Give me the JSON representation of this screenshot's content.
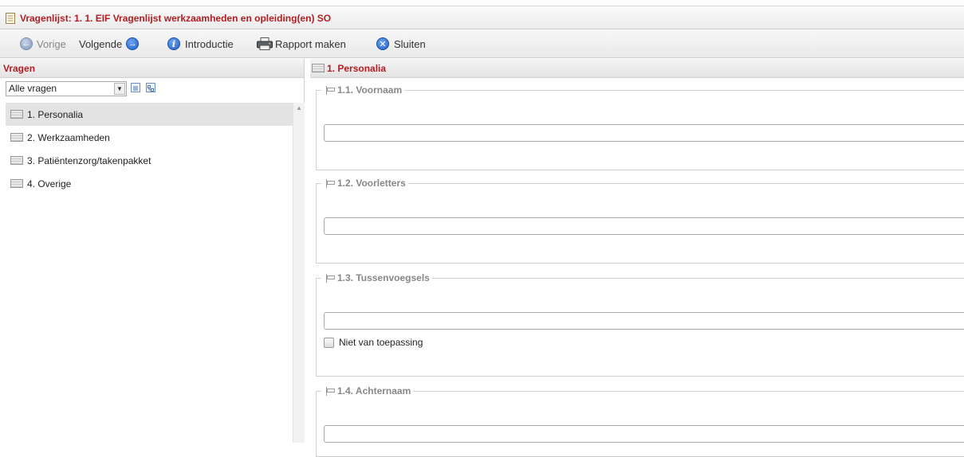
{
  "window": {
    "title": "Vragenlijst: 1. 1. EIF Vragenlijst werkzaamheden en opleiding(en) SO"
  },
  "toolbar": {
    "previous_label": "Vorige",
    "next_label": "Volgende",
    "intro_label": "Introductie",
    "report_label": "Rapport maken",
    "close_label": "Sluiten"
  },
  "sidebar": {
    "header": "Vragen",
    "filter_selected": "Alle vragen",
    "items": [
      {
        "label": "1. Personalia",
        "active": true
      },
      {
        "label": "2. Werkzaamheden",
        "active": false
      },
      {
        "label": "3. Patiëntenzorg/takenpakket",
        "active": false
      },
      {
        "label": "4. Overige",
        "active": false
      }
    ]
  },
  "main": {
    "section_title": "1. Personalia",
    "questions": [
      {
        "legend": "1.1. Voornaam",
        "value": ""
      },
      {
        "legend": "1.2. Voorletters",
        "value": ""
      },
      {
        "legend": "1.3. Tussenvoegsels",
        "value": "",
        "checkbox_label": "Niet van toepassing"
      },
      {
        "legend": "1.4. Achternaam",
        "value": ""
      }
    ]
  },
  "colors": {
    "accent": "#b21d22",
    "icon_blue": "#1f5fc7"
  }
}
